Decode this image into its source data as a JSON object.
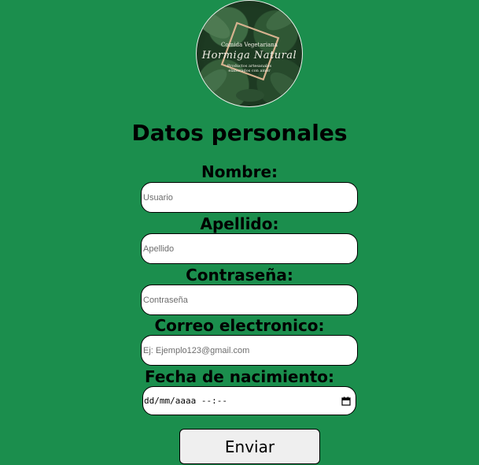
{
  "logo": {
    "top_text": "Comida Vegetariana",
    "name": "Hormiga Natural",
    "subtitle": "Productos artesanales elaborados con amor"
  },
  "form": {
    "title": "Datos personales",
    "fields": [
      {
        "label": "Nombre:",
        "placeholder": "Usuario",
        "type": "text"
      },
      {
        "label": "Apellido:",
        "placeholder": "Apellido",
        "type": "text"
      },
      {
        "label": "Contraseña:",
        "placeholder": "Contraseña",
        "type": "password"
      },
      {
        "label": "Correo electronico:",
        "placeholder": "Ej: Ejemplo123@gmail.com",
        "type": "email"
      },
      {
        "label": "Fecha de nacimiento:",
        "value_display": "dd/mm/aaaa  --:--",
        "type": "datetime-local"
      }
    ],
    "submit_label": "Enviar"
  },
  "colors": {
    "background": "#1b8e4d",
    "button": "#efefef"
  }
}
